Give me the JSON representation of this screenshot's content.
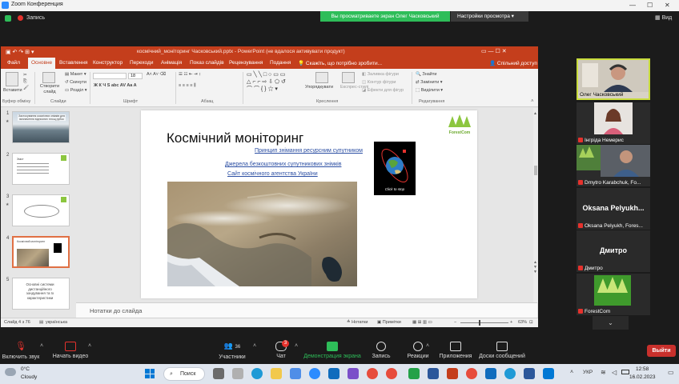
{
  "zoom": {
    "window_title": "Zoom Конференция",
    "recording_label": "Запись",
    "share_banner": "Вы просматриваете экран Олег Часковський",
    "view_settings": "Настройки просмотра",
    "view_button": "Вид",
    "participants": [
      {
        "name": "Олег Часковський",
        "type": "video"
      },
      {
        "name": "Інгріда Немерис",
        "type": "video",
        "muted": true
      },
      {
        "name": "Dmytro Karabchuk, Fo...",
        "type": "video",
        "muted": true
      },
      {
        "big": "Oksana Pelyukh...",
        "name": "Oksana Pelyukh, Fores...",
        "type": "name",
        "muted": true
      },
      {
        "big": "Дмитро",
        "name": "Дмитро",
        "type": "name",
        "muted": true
      },
      {
        "name": "ForestCom",
        "type": "logo",
        "muted": true
      }
    ],
    "toolbar": {
      "audio": "Включить звук",
      "video": "Начать видео",
      "participants": "Участники",
      "participants_count": "36",
      "chat": "Чат",
      "chat_badge": "3",
      "share": "Демонстрация экрана",
      "record": "Запись",
      "reactions": "Реакции",
      "apps": "Приложения",
      "whiteboard": "Доски сообщений",
      "leave": "Выйти"
    }
  },
  "ppt": {
    "title": "космічний_моніторинг Часковський.pptx - PowerPoint (не вдалося активувати продукт)",
    "tabs": [
      "Файл",
      "Основне",
      "Вставлення",
      "Конструктор",
      "Переходи",
      "Анімація",
      "Показ слайдів",
      "Рецензування",
      "Подання",
      "Скажіть, що потрібно зробити..."
    ],
    "share_label": "Спільний доступ",
    "ribbon": {
      "paste": "Вставити",
      "clipboard": "Буфер обміну",
      "new_slide": "Створити слайд",
      "layout": "Макет",
      "reset": "Скинути",
      "section": "Розділ",
      "slides": "Слайди",
      "font_size": "18",
      "font": "Шрифт",
      "paragraph": "Абзац",
      "drawing": "Креслення",
      "arrange": "Упорядкувати",
      "quick_styles": "Експрес-стилі",
      "shape_fill": "Заливка фігури",
      "shape_outline": "Контур фігури",
      "shape_effects": "Ефекти для фігур",
      "find": "Знайти",
      "replace": "Замінити",
      "select": "Виділити",
      "editing": "Редагування"
    },
    "thumbnails": [
      {
        "num": "1",
        "text": "Застосування космічних знімків для визначення відносних площ рубок"
      },
      {
        "num": "2",
        "text": "Зміст"
      },
      {
        "num": "3",
        "text": ""
      },
      {
        "num": "4",
        "text": "Космічний моніторинг"
      },
      {
        "num": "5",
        "text": "Основні системи дистанційного зондування та їх характеристики"
      }
    ],
    "slide": {
      "title": "Космічний моніторинг",
      "links": [
        "Принцип знімання ресурсним супутником",
        "Джерела безкоштовних супутникових знімків",
        "Сайт космічного агентства України"
      ],
      "logo": "ForestCom",
      "animation_caption": "Click to stop"
    },
    "notes_placeholder": "Нотатки до слайда",
    "status": {
      "slide_info": "Слайд 4 з 76",
      "language": "українська",
      "notes": "Нотатки",
      "comments": "Примітки",
      "zoom": "63%"
    }
  },
  "taskbar": {
    "temperature": "0°C",
    "weather": "Cloudy",
    "search": "Поиск",
    "lang": "УКР",
    "time": "12:58",
    "date": "16.02.2023"
  },
  "colors": {
    "ppt_accent": "#c43e1c",
    "zoom_green": "#2ebd59",
    "leave_red": "#c9302c"
  }
}
